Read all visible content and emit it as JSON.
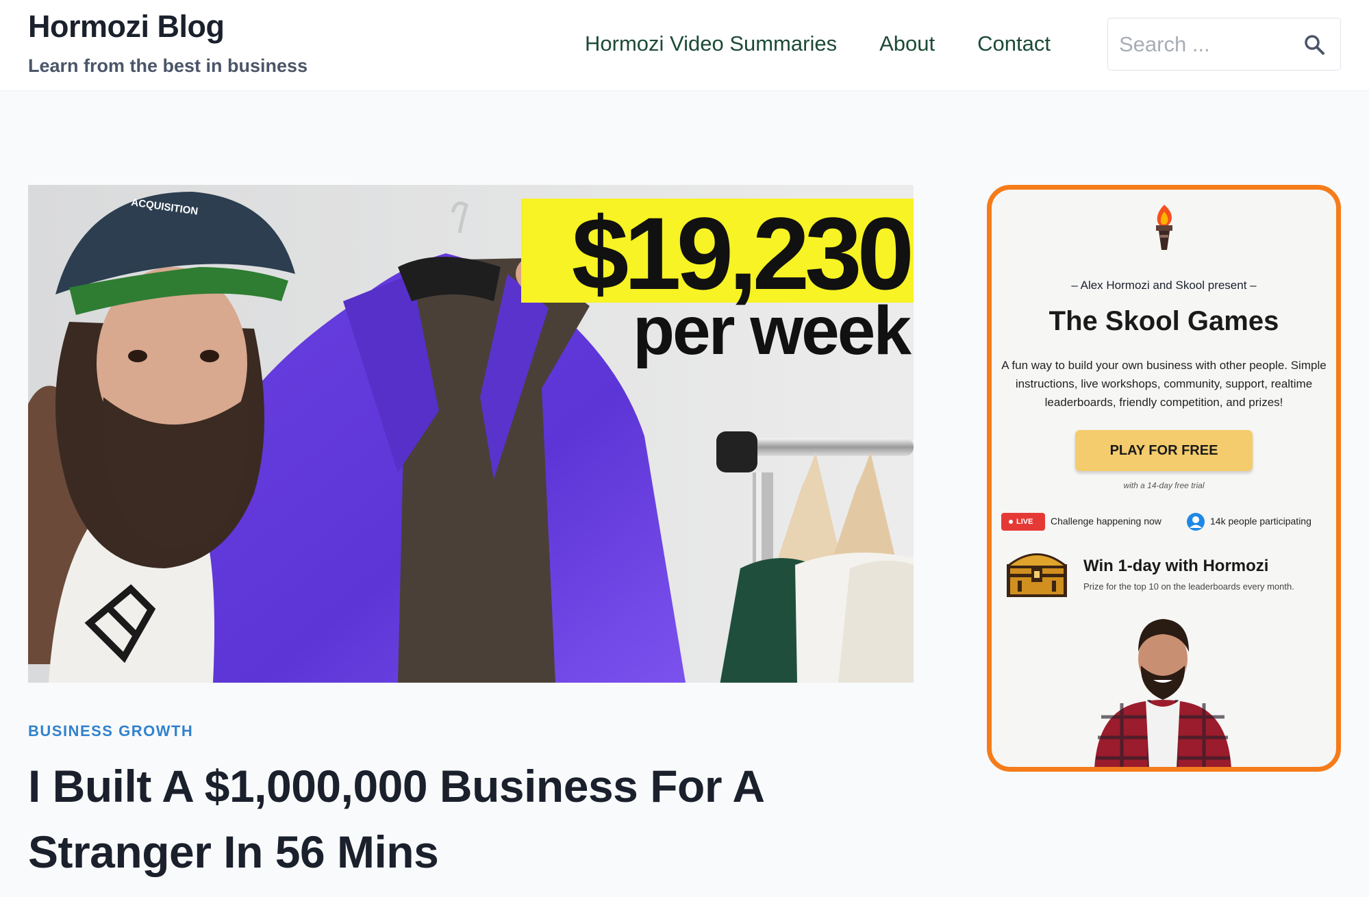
{
  "site": {
    "title": "Hormozi Blog",
    "tagline": "Learn from the best in business"
  },
  "nav": {
    "items": [
      {
        "label": "Hormozi Video Summaries"
      },
      {
        "label": "About"
      },
      {
        "label": "Contact"
      }
    ]
  },
  "search": {
    "placeholder": "Search ...",
    "value": ""
  },
  "hero": {
    "price_text": "$19,230",
    "sub_text": "per week",
    "cap_text": "ACQUISITION"
  },
  "post": {
    "category": "BUSINESS GROWTH",
    "title": "I Built A $1,000,000 Business For A Stranger In 56 Mins"
  },
  "ad": {
    "presenter": "– Alex Hormozi and Skool present –",
    "title": "The Skool Games",
    "description": "A fun way to build your own business with other people. Simple instructions, live workshops, community, support, realtime leaderboards, friendly competition, and prizes!",
    "cta_label": "PLAY FOR FREE",
    "trial_note": "with a 14-day free trial",
    "live_badge": "LIVE",
    "live_text": "Challenge happening now",
    "people_text": "14k people participating",
    "prize_title": "Win 1-day with Hormozi",
    "prize_subtitle": "Prize for the top 10 on the leaderboards every month."
  },
  "colors": {
    "accent_nav": "#1c4a36",
    "category_blue": "#3182ce",
    "ad_border": "#f57c1a",
    "cta_bg": "#f4cc6d",
    "price_highlight": "#f7f324",
    "jacket_purple": "#6a3fe0"
  },
  "icons": {
    "search": "search-icon",
    "torch": "torch-icon",
    "people": "people-icon",
    "treasure": "treasure-chest-icon"
  }
}
